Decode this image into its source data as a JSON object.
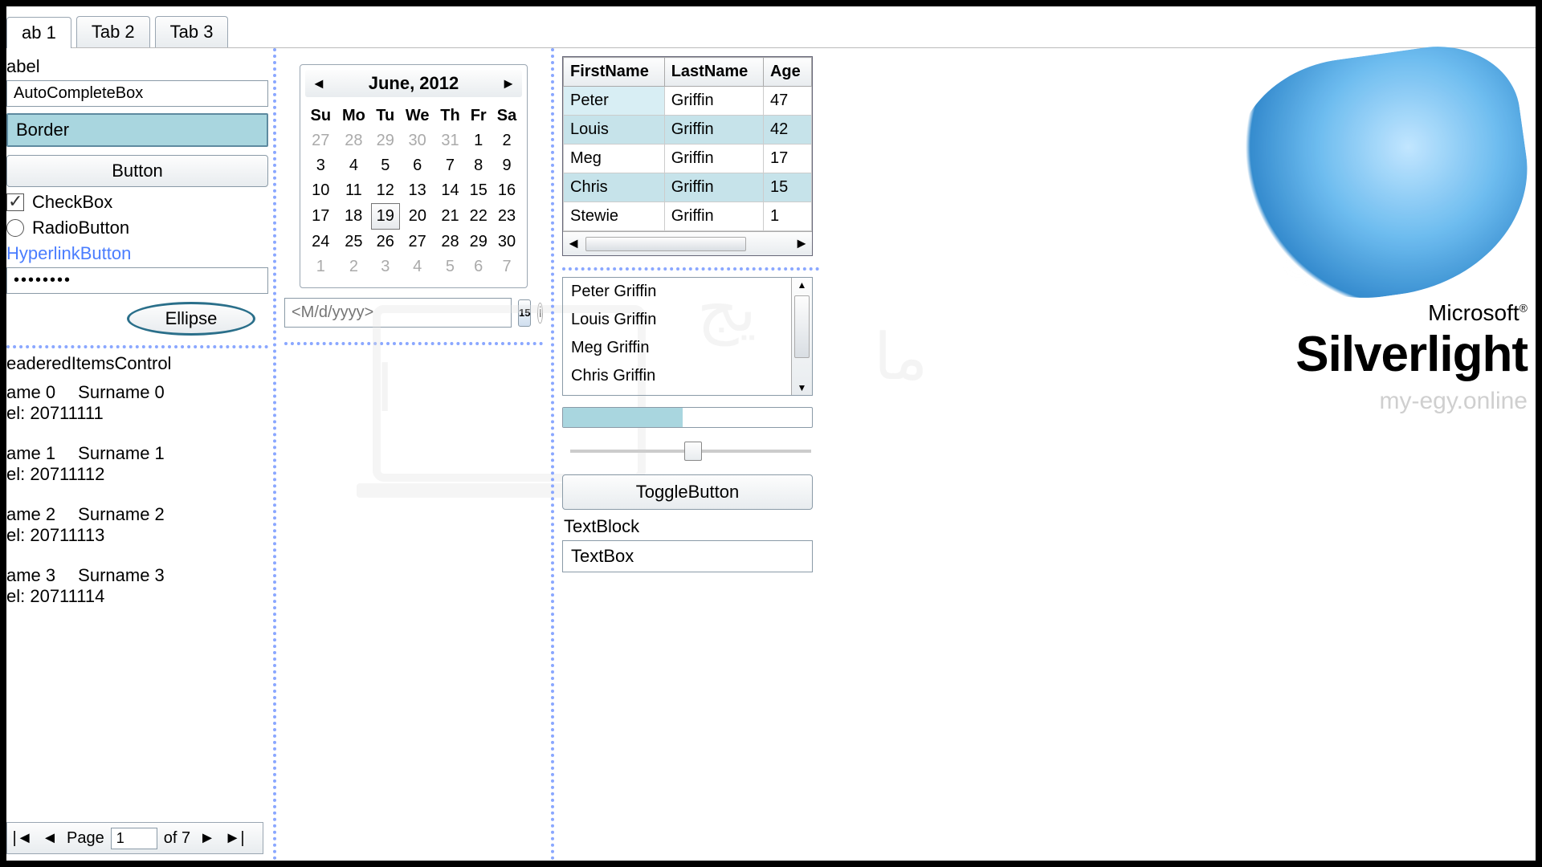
{
  "tabs": {
    "t0": "ab 1",
    "t1": "Tab 2",
    "t2": "Tab 3"
  },
  "left": {
    "label": "abel",
    "autocomplete": "AutoCompleteBox",
    "border": "Border",
    "button": "Button",
    "checkbox": "CheckBox",
    "radio": "RadioButton",
    "hyperlink": "HyperlinkButton",
    "password": "••••••••",
    "ellipse": "Ellipse",
    "headeredTitle": "eaderedItemsControl",
    "records": [
      {
        "name": "ame 0",
        "surname": "Surname 0",
        "tel": "el: 20711111"
      },
      {
        "name": "ame 1",
        "surname": "Surname 1",
        "tel": "el: 20711112"
      },
      {
        "name": "ame 2",
        "surname": "Surname 2",
        "tel": "el: 20711113"
      },
      {
        "name": "ame 3",
        "surname": "Surname 3",
        "tel": "el: 20711114"
      }
    ],
    "pager": {
      "pageLabel": "Page",
      "page": "1",
      "ofLabel": "of 7"
    }
  },
  "calendar": {
    "title": "June, 2012",
    "dow": [
      "Su",
      "Mo",
      "Tu",
      "We",
      "Th",
      "Fr",
      "Sa"
    ],
    "weeks": [
      [
        {
          "d": "27",
          "o": true
        },
        {
          "d": "28",
          "o": true
        },
        {
          "d": "29",
          "o": true
        },
        {
          "d": "30",
          "o": true
        },
        {
          "d": "31",
          "o": true
        },
        {
          "d": "1"
        },
        {
          "d": "2"
        }
      ],
      [
        {
          "d": "3"
        },
        {
          "d": "4"
        },
        {
          "d": "5"
        },
        {
          "d": "6"
        },
        {
          "d": "7"
        },
        {
          "d": "8"
        },
        {
          "d": "9"
        }
      ],
      [
        {
          "d": "10"
        },
        {
          "d": "11"
        },
        {
          "d": "12"
        },
        {
          "d": "13"
        },
        {
          "d": "14"
        },
        {
          "d": "15"
        },
        {
          "d": "16"
        }
      ],
      [
        {
          "d": "17"
        },
        {
          "d": "18"
        },
        {
          "d": "19",
          "t": true
        },
        {
          "d": "20"
        },
        {
          "d": "21"
        },
        {
          "d": "22"
        },
        {
          "d": "23"
        }
      ],
      [
        {
          "d": "24"
        },
        {
          "d": "25"
        },
        {
          "d": "26"
        },
        {
          "d": "27"
        },
        {
          "d": "28"
        },
        {
          "d": "29"
        },
        {
          "d": "30"
        }
      ],
      [
        {
          "d": "1",
          "o": true
        },
        {
          "d": "2",
          "o": true
        },
        {
          "d": "3",
          "o": true
        },
        {
          "d": "4",
          "o": true
        },
        {
          "d": "5",
          "o": true
        },
        {
          "d": "6",
          "o": true
        },
        {
          "d": "7",
          "o": true
        }
      ]
    ],
    "datepicker_placeholder": "<M/d/yyyy>",
    "datepicker_badge": "15"
  },
  "grid": {
    "headers": [
      "FirstName",
      "LastName",
      "Age"
    ],
    "rows": [
      [
        "Peter",
        "Griffin",
        "47"
      ],
      [
        "Louis",
        "Griffin",
        "42"
      ],
      [
        "Meg",
        "Griffin",
        "17"
      ],
      [
        "Chris",
        "Griffin",
        "15"
      ],
      [
        "Stewie",
        "Griffin",
        "1"
      ]
    ]
  },
  "listbox": [
    "Peter Griffin",
    "Louis Griffin",
    "Meg Griffin",
    "Chris Griffin"
  ],
  "right": {
    "toggle": "ToggleButton",
    "textblock": "TextBlock",
    "textbox": "TextBox"
  },
  "logo": {
    "ms": "Microsoft",
    "reg": "®",
    "sl": "Silverlight",
    "wm": "my-egy.online"
  },
  "nav": {
    "prev": "◄",
    "next": "►",
    "first": "|◄",
    "prev1": "◄",
    "next1": "►",
    "last": "►|"
  }
}
